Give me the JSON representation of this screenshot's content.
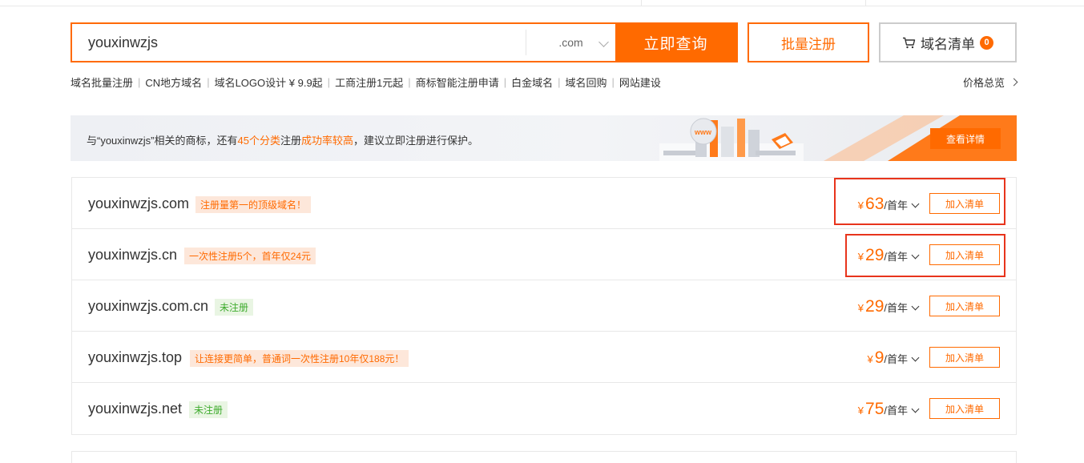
{
  "search": {
    "query": "youxinwzjs",
    "suffix": ".com",
    "button_label": "立即查询"
  },
  "header": {
    "batch_label": "批量注册",
    "cart_label": "域名清单",
    "cart_count": "0"
  },
  "quicklinks": [
    "域名批量注册",
    "CN地方域名",
    "域名LOGO设计 ¥ 9.9起",
    "工商注册1元起",
    "商标智能注册申请",
    "白金域名",
    "域名回购",
    "网站建设"
  ],
  "price_overview": "价格总览",
  "banner": {
    "prefix": "与“youxinwzjs”相关的商标，还有",
    "highlight1": "45个分类",
    "middle": "注册",
    "highlight2": "成功率较高",
    "suffix": "，建议立即注册进行保护。",
    "button_label": "查看详情"
  },
  "results": [
    {
      "domain": "youxinwzjs.com",
      "tag": "注册量第一的顶级域名！",
      "tag_style": "orange",
      "currency": "¥",
      "price": "63",
      "unit": "/首年",
      "add_label": "加入清单"
    },
    {
      "domain": "youxinwzjs.cn",
      "tag": "一次性注册5个，首年仅24元",
      "tag_style": "orange",
      "currency": "¥",
      "price": "29",
      "unit": "/首年",
      "add_label": "加入清单"
    },
    {
      "domain": "youxinwzjs.com.cn",
      "tag": "未注册",
      "tag_style": "green",
      "currency": "¥",
      "price": "29",
      "unit": "/首年",
      "add_label": "加入清单"
    },
    {
      "domain": "youxinwzjs.top",
      "tag": "让连接更简单，普通词一次性注册10年仅188元！",
      "tag_style": "orange",
      "currency": "¥",
      "price": "9",
      "unit": "/首年",
      "add_label": "加入清单"
    },
    {
      "domain": "youxinwzjs.net",
      "tag": "未注册",
      "tag_style": "green",
      "currency": "¥",
      "price": "75",
      "unit": "/首年",
      "add_label": "加入清单"
    }
  ],
  "colors": {
    "accent": "#ff6a00",
    "highlight_box": "#e8341c",
    "tag_green": "#3eab2d"
  }
}
